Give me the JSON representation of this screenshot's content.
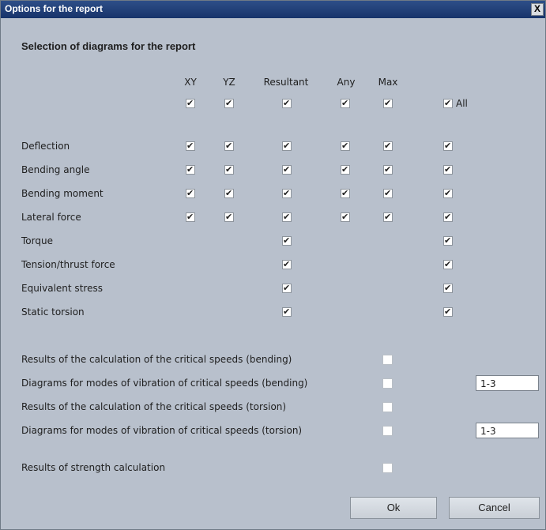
{
  "window": {
    "title": "Options for the report",
    "close_label": "X"
  },
  "section_title": "Selection of diagrams for the report",
  "columns": [
    "XY",
    "YZ",
    "Resultant",
    "Any",
    "Max"
  ],
  "all_label": "All",
  "diagram_rows": [
    {
      "label": "Deflection"
    },
    {
      "label": "Bending angle"
    },
    {
      "label": "Bending moment"
    },
    {
      "label": "Lateral force"
    },
    {
      "label": "Torque"
    },
    {
      "label": "Tension/thrust force"
    },
    {
      "label": "Equivalent stress"
    },
    {
      "label": "Static torsion"
    }
  ],
  "results_rows": [
    {
      "label": "Results of the calculation of the critical speeds (bending)",
      "checked": false
    },
    {
      "label": "Diagrams for modes of vibration of critical speeds (bending)",
      "checked": false,
      "value": "1-3"
    },
    {
      "label": "Results of the calculation of the critical speeds (torsion)",
      "checked": false
    },
    {
      "label": "Diagrams for modes of vibration of critical speeds (torsion)",
      "checked": false,
      "value": "1-3"
    },
    {
      "label": "Results of strength calculation",
      "checked": false
    }
  ],
  "buttons": {
    "ok": "Ok",
    "cancel": "Cancel"
  }
}
